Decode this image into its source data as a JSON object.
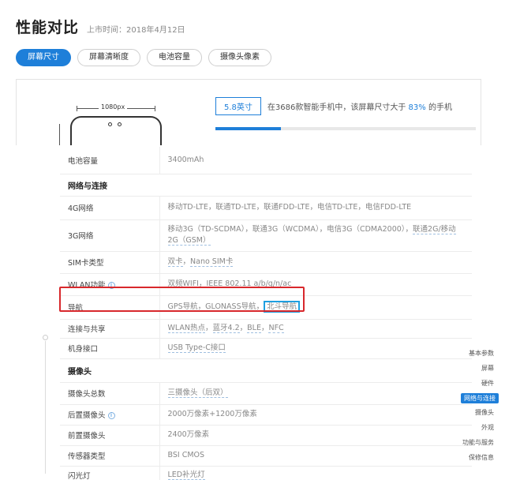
{
  "header": {
    "title": "性能对比",
    "release_date": "上市时间：2018年4月12日"
  },
  "tabs": [
    {
      "label": "屏幕尺寸",
      "active": true
    },
    {
      "label": "屏幕清晰度",
      "active": false
    },
    {
      "label": "电池容量",
      "active": false
    },
    {
      "label": "摄像头像素",
      "active": false
    }
  ],
  "screen_panel": {
    "width_label": "1080px",
    "badge": "5.8英寸",
    "stat_prefix": "在3686款智能手机中，该屏幕尺寸大于",
    "stat_percent": "83%",
    "stat_suffix": "的手机",
    "bar_fraction": 0.25
  },
  "side_nav": [
    {
      "label": "基本参数"
    },
    {
      "label": "屏幕"
    },
    {
      "label": "硬件"
    },
    {
      "label": "网络与连接",
      "active": true
    },
    {
      "label": "摄像头"
    },
    {
      "label": "外观"
    },
    {
      "label": "功能与服务"
    },
    {
      "label": "保修信息"
    }
  ],
  "specs": {
    "battery_key": "电池容量",
    "battery_val": "3400mAh",
    "network_section": "网络与连接",
    "net4g_key": "4G网络",
    "net4g_val": "移动TD-LTE，联通TD-LTE，联通FDD-LTE，电信TD-LTE，电信FDD-LTE",
    "net3g_key": "3G网络",
    "net3g_val_a": "移动3G（TD-SCDMA），联通3G（WCDMA），电信3G（CDMA2000），",
    "net3g_val_b": "联通2G/移动",
    "net3g_val_c": "2G（GSM）",
    "sim_key": "SIM卡类型",
    "sim_val_a": "双卡",
    "sim_val_b": "Nano SIM卡",
    "wlan_key": "WLAN功能",
    "wlan_val": "双频WIFI，IEEE 802.11 a/b/g/n/ac",
    "nav_key": "导航",
    "nav_gps": "GPS导航",
    "nav_glonass": "GLONASS导航",
    "nav_beidou": "北斗导航",
    "conn_key": "连接与共享",
    "conn_wlan": "WLAN热点",
    "conn_bt": "蓝牙4.2",
    "conn_ble": "BLE",
    "conn_nfc": "NFC",
    "port_key": "机身接口",
    "port_val": "USB Type-C接口",
    "camera_section": "摄像头",
    "cam_total_key": "摄像头总数",
    "cam_total_val": "三摄像头（后双）",
    "rear_key": "后置摄像头",
    "rear_val": "2000万像素+1200万像素",
    "front_key": "前置摄像头",
    "front_val": "2400万像素",
    "sensor_key": "传感器类型",
    "sensor_val": "BSI CMOS",
    "flash_key": "闪光灯",
    "flash_val": "LED补光灯"
  },
  "colors": {
    "accent": "#1e7fd9",
    "highlight_border": "#d8282c",
    "beidou_border": "#1e9fe0"
  }
}
